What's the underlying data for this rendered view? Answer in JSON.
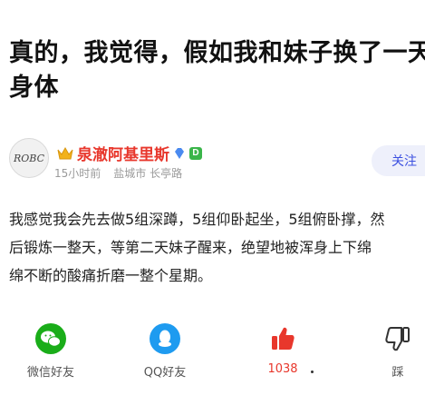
{
  "post": {
    "title": "真的，我觉得，假如我和妹子换了一天\n身体"
  },
  "author": {
    "avatar_text": "ROBC",
    "name": "泉澈阿基里斯",
    "badge_text": "D",
    "time": "15小时前",
    "location": "盐城市 长亭路",
    "icons": [
      "crown-icon",
      "diamond-icon",
      "level-badge-icon"
    ]
  },
  "follow_label": "关注",
  "content": "我感觉我会先去做5组深蹲，5组仰卧起坐，5组俯卧撑，然\n后锻炼一整天，等第二天妹子醒来，绝望地被浑身上下绵\n绵不断的酸痛折磨一整个星期。",
  "actions": {
    "wechat_label": "微信好友",
    "qq_label": "QQ好友",
    "like_count": "1038",
    "dislike_label": "踩"
  },
  "colors": {
    "accent_red": "#e8372c",
    "follow_blue": "#3c50e0",
    "wechat_green": "#1aad19",
    "qq_blue": "#1e9bf0"
  }
}
